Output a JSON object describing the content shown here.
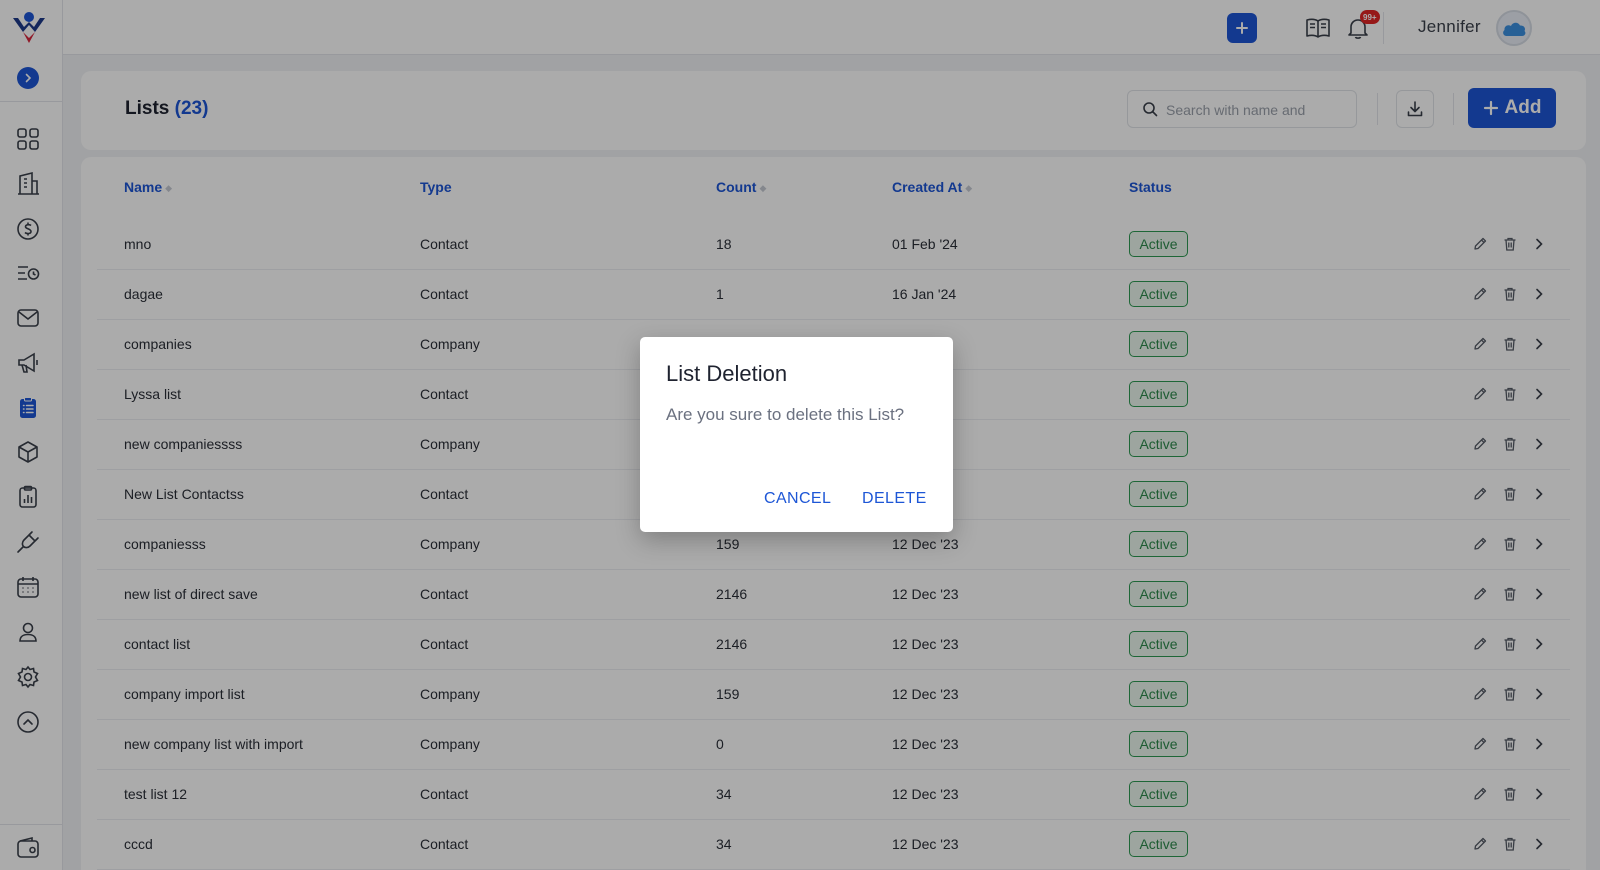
{
  "topbar": {
    "user_name": "Jennifer",
    "notification_count": "99+"
  },
  "header": {
    "title": "Lists",
    "count": "(23)",
    "search_placeholder": "Search with name and",
    "add_label": "Add"
  },
  "table": {
    "columns": {
      "name": "Name",
      "type": "Type",
      "count": "Count",
      "created_at": "Created At",
      "status": "Status"
    },
    "rows": [
      {
        "name": "mno",
        "type": "Contact",
        "count": "18",
        "created": "01 Feb '24",
        "status": "Active"
      },
      {
        "name": "dagae",
        "type": "Contact",
        "count": "1",
        "created": "16 Jan '24",
        "status": "Active"
      },
      {
        "name": "companies",
        "type": "Company",
        "count": "",
        "created": "",
        "status": "Active"
      },
      {
        "name": "Lyssa list",
        "type": "Contact",
        "count": "",
        "created": "",
        "status": "Active"
      },
      {
        "name": "new companiessss",
        "type": "Company",
        "count": "",
        "created": "",
        "status": "Active"
      },
      {
        "name": "New List Contactss",
        "type": "Contact",
        "count": "",
        "created": "",
        "status": "Active"
      },
      {
        "name": "companiesss",
        "type": "Company",
        "count": "159",
        "created": "12 Dec '23",
        "status": "Active"
      },
      {
        "name": "new list of direct save",
        "type": "Contact",
        "count": "2146",
        "created": "12 Dec '23",
        "status": "Active"
      },
      {
        "name": "contact list",
        "type": "Contact",
        "count": "2146",
        "created": "12 Dec '23",
        "status": "Active"
      },
      {
        "name": "company import list",
        "type": "Company",
        "count": "159",
        "created": "12 Dec '23",
        "status": "Active"
      },
      {
        "name": "new company list with import",
        "type": "Company",
        "count": "0",
        "created": "12 Dec '23",
        "status": "Active"
      },
      {
        "name": "test list 12",
        "type": "Contact",
        "count": "34",
        "created": "12 Dec '23",
        "status": "Active"
      },
      {
        "name": "cccd",
        "type": "Contact",
        "count": "34",
        "created": "12 Dec '23",
        "status": "Active"
      }
    ]
  },
  "dialog": {
    "title": "List Deletion",
    "message": "Are you sure to delete this List?",
    "cancel_label": "CANCEL",
    "delete_label": "DELETE"
  },
  "colors": {
    "primary": "#1d56d6",
    "active_green": "#2e9a53",
    "badge_red": "#e02424"
  }
}
